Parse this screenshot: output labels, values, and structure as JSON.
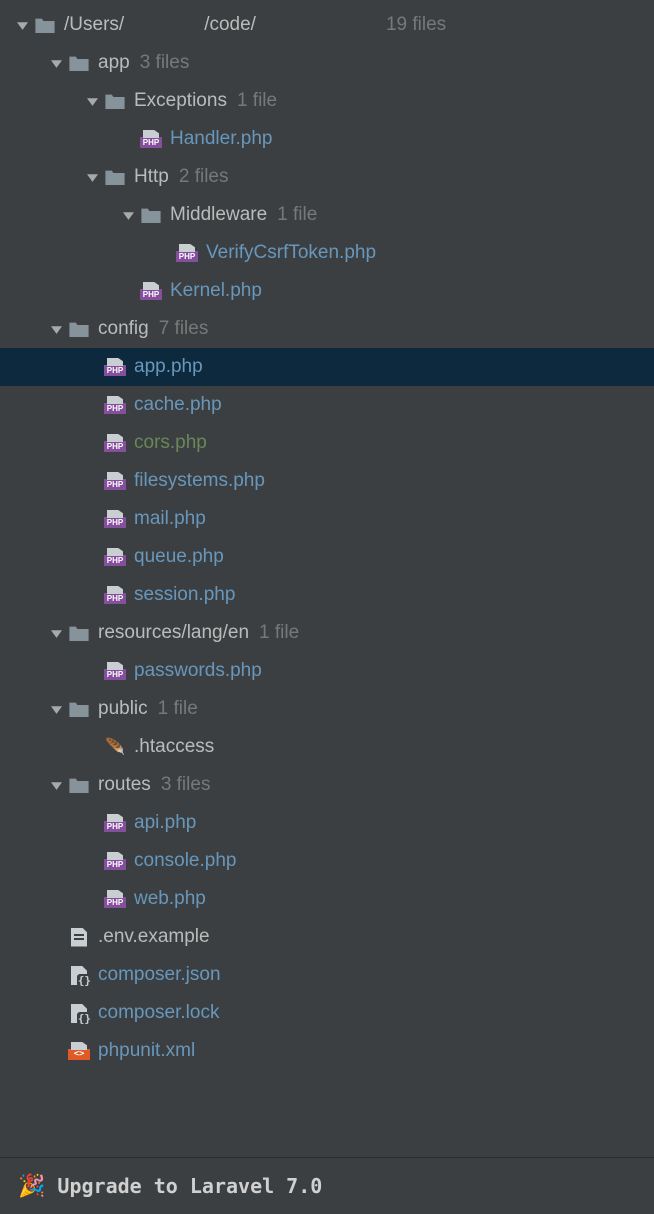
{
  "root": {
    "path_prefix": "/Users/",
    "path_mid": "/code/",
    "count": "19 files"
  },
  "tree": [
    {
      "depth": 1,
      "chev": true,
      "icon": "folder",
      "name": "app",
      "color": "gray",
      "count": "3 files"
    },
    {
      "depth": 2,
      "chev": true,
      "icon": "folder",
      "name": "Exceptions",
      "color": "gray",
      "count": "1 file"
    },
    {
      "depth": 3,
      "chev": false,
      "icon": "php",
      "name": "Handler.php",
      "color": "blue"
    },
    {
      "depth": 2,
      "chev": true,
      "icon": "folder",
      "name": "Http",
      "color": "gray",
      "count": "2 files"
    },
    {
      "depth": 3,
      "chev": true,
      "icon": "folder",
      "name": "Middleware",
      "color": "gray",
      "count": "1 file"
    },
    {
      "depth": 4,
      "chev": false,
      "icon": "php",
      "name": "VerifyCsrfToken.php",
      "color": "blue"
    },
    {
      "depth": 3,
      "chev": false,
      "icon": "php",
      "name": "Kernel.php",
      "color": "blue"
    },
    {
      "depth": 1,
      "chev": true,
      "icon": "folder",
      "name": "config",
      "color": "gray",
      "count": "7 files"
    },
    {
      "depth": 2,
      "chev": false,
      "icon": "php",
      "name": "app.php",
      "color": "blue",
      "selected": true
    },
    {
      "depth": 2,
      "chev": false,
      "icon": "php",
      "name": "cache.php",
      "color": "blue"
    },
    {
      "depth": 2,
      "chev": false,
      "icon": "php",
      "name": "cors.php",
      "color": "green"
    },
    {
      "depth": 2,
      "chev": false,
      "icon": "php",
      "name": "filesystems.php",
      "color": "blue"
    },
    {
      "depth": 2,
      "chev": false,
      "icon": "php",
      "name": "mail.php",
      "color": "blue"
    },
    {
      "depth": 2,
      "chev": false,
      "icon": "php",
      "name": "queue.php",
      "color": "blue"
    },
    {
      "depth": 2,
      "chev": false,
      "icon": "php",
      "name": "session.php",
      "color": "blue"
    },
    {
      "depth": 1,
      "chev": true,
      "icon": "folder",
      "name": "resources/lang/en",
      "color": "gray",
      "count": "1 file"
    },
    {
      "depth": 2,
      "chev": false,
      "icon": "php",
      "name": "passwords.php",
      "color": "blue"
    },
    {
      "depth": 1,
      "chev": true,
      "icon": "folder",
      "name": "public",
      "color": "gray",
      "count": "1 file"
    },
    {
      "depth": 2,
      "chev": false,
      "icon": "htaccess",
      "name": ".htaccess",
      "color": "gray"
    },
    {
      "depth": 1,
      "chev": true,
      "icon": "folder",
      "name": "routes",
      "color": "gray",
      "count": "3 files"
    },
    {
      "depth": 2,
      "chev": false,
      "icon": "php",
      "name": "api.php",
      "color": "blue"
    },
    {
      "depth": 2,
      "chev": false,
      "icon": "php",
      "name": "console.php",
      "color": "blue"
    },
    {
      "depth": 2,
      "chev": false,
      "icon": "php",
      "name": "web.php",
      "color": "blue"
    },
    {
      "depth": 1,
      "chev": false,
      "icon": "file",
      "name": ".env.example",
      "color": "gray"
    },
    {
      "depth": 1,
      "chev": false,
      "icon": "json",
      "name": "composer.json",
      "color": "blue"
    },
    {
      "depth": 1,
      "chev": false,
      "icon": "json",
      "name": "composer.lock",
      "color": "blue"
    },
    {
      "depth": 1,
      "chev": false,
      "icon": "xml",
      "name": "phpunit.xml",
      "color": "blue"
    }
  ],
  "upgrade": {
    "emoji": "🎉",
    "text": "Upgrade to Laravel 7.0"
  },
  "icon_labels": {
    "php": "PHP",
    "xml": "<>"
  }
}
